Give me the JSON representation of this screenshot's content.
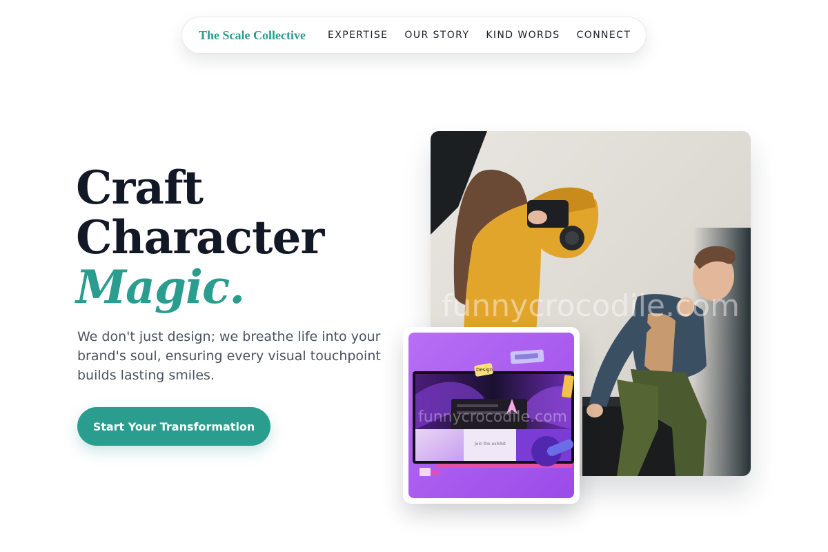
{
  "nav": {
    "brand": "The Scale Collective",
    "links": [
      "EXPERTISE",
      "OUR STORY",
      "KIND WORDS",
      "CONNECT"
    ]
  },
  "hero": {
    "title_line1": "Craft",
    "title_line2": "Character",
    "title_accent": "Magic.",
    "subtitle": "We don't just design; we breathe life into your brand's soul, ensuring every visual touchpoint builds lasting smiles.",
    "cta_label": "Start Your Transformation"
  },
  "images": {
    "main_watermark": "funnycrocodile.com",
    "card_watermark": "funnycrocodile.com",
    "card_sticker": "Design",
    "card_screen_caption": "Join the exhibit"
  },
  "colors": {
    "accent": "#2a9d8f",
    "heading": "#121826",
    "body_text": "#4a5260",
    "card_bg": "#a855f7"
  }
}
